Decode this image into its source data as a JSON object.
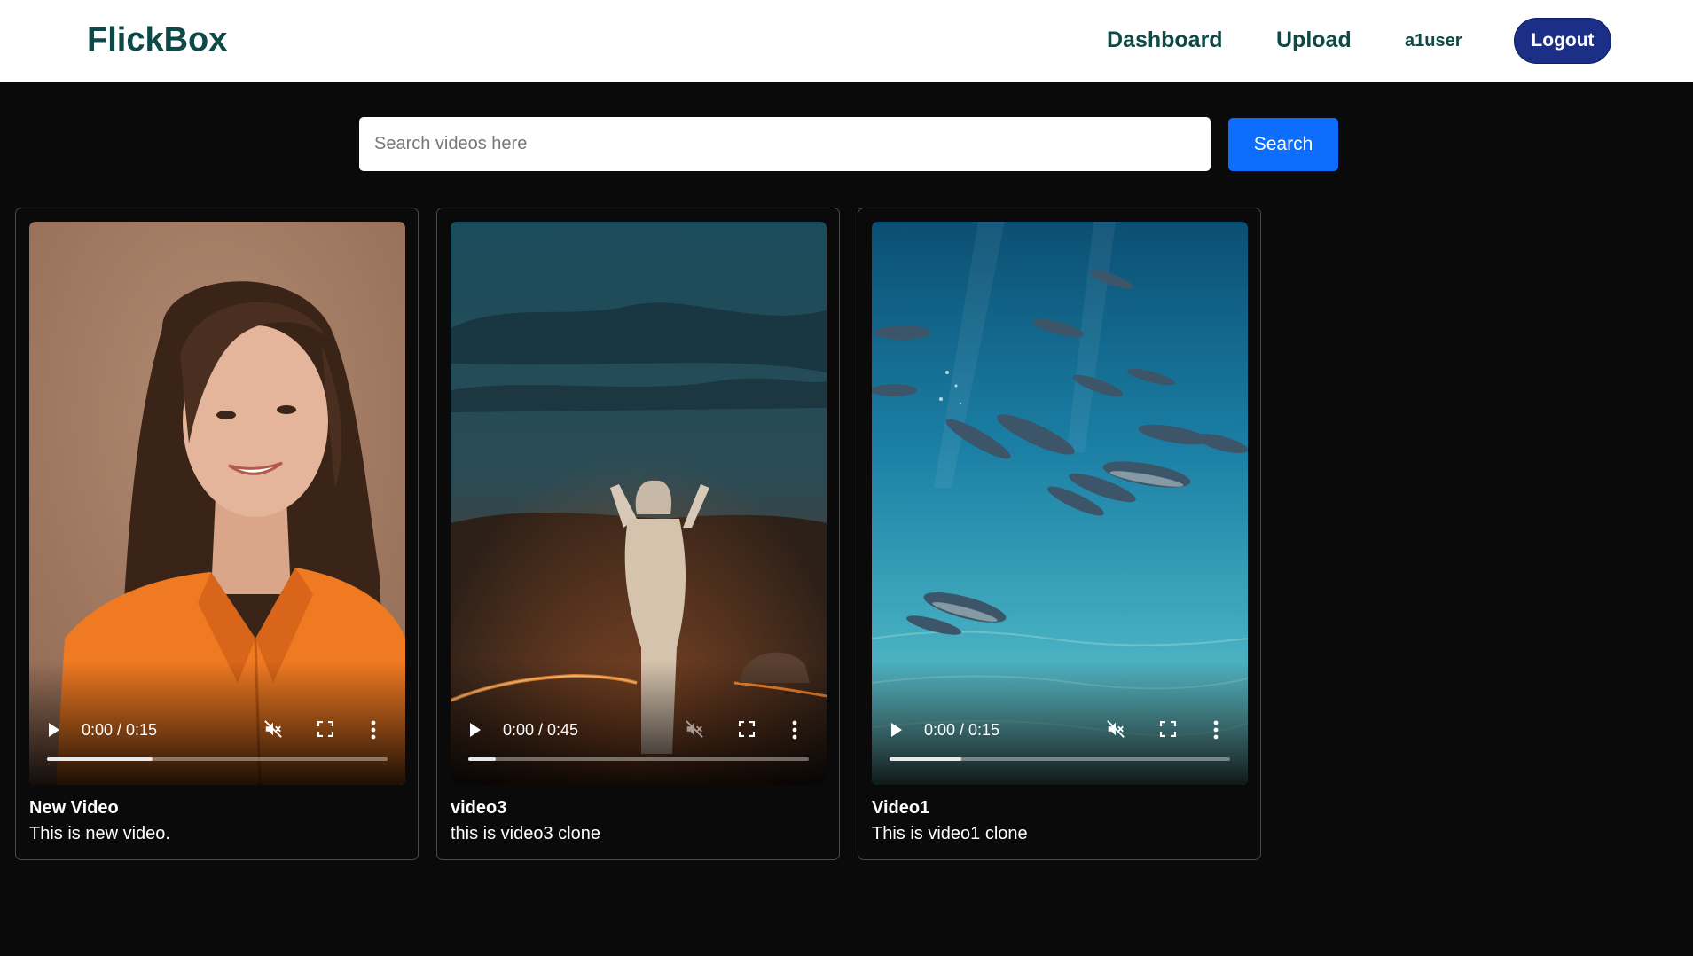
{
  "brand": "FlickBox",
  "nav": {
    "dashboard": "Dashboard",
    "upload": "Upload",
    "username": "a1user",
    "logout": "Logout"
  },
  "search": {
    "placeholder": "Search videos here",
    "value": "",
    "button": "Search"
  },
  "colors": {
    "brand_text": "#0d4a47",
    "logout_bg": "#1b2f86",
    "search_button": "#0d6efd",
    "page_bg": "#0a0a0a"
  },
  "videos": [
    {
      "title": "New Video",
      "description": "This is new video.",
      "time": "0:00 / 0:15",
      "buffered": 0.31,
      "scene": "woman-in-orange-shirt"
    },
    {
      "title": "video3",
      "description": "this is video3 clone",
      "time": "0:00 / 0:45",
      "buffered": 0.08,
      "scene": "figure-standing-by-fire-at-dusk"
    },
    {
      "title": "Video1",
      "description": "This is video1 clone",
      "time": "0:00 / 0:15",
      "buffered": 0.21,
      "scene": "dolphins-underwater"
    }
  ]
}
